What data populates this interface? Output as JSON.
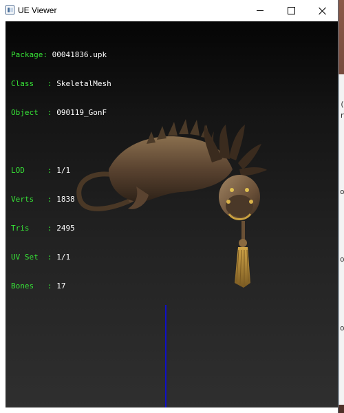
{
  "window": {
    "title": "UE Viewer"
  },
  "info": {
    "package_label": "Package",
    "package_value": "00041836.upk",
    "class_label": "Class",
    "class_value": "SkeletalMesh",
    "object_label": "Object",
    "object_value": "090119_GonF",
    "lod_label": "LOD",
    "lod_value": "1/1",
    "verts_label": "Verts",
    "verts_value": "1838",
    "tris_label": "Tris",
    "tris_value": "2495",
    "uvset_label": "UV Set",
    "uvset_value": "1/1",
    "bones_label": "Bones",
    "bones_value": "17"
  },
  "colors": {
    "label_green": "#37e437",
    "value_white": "#ffffff",
    "axis_blue": "#1010c8"
  },
  "icons": {
    "app": "ue-viewer-app-icon",
    "minimize": "minimize-icon",
    "maximize": "maximize-icon",
    "close": "close-icon"
  }
}
